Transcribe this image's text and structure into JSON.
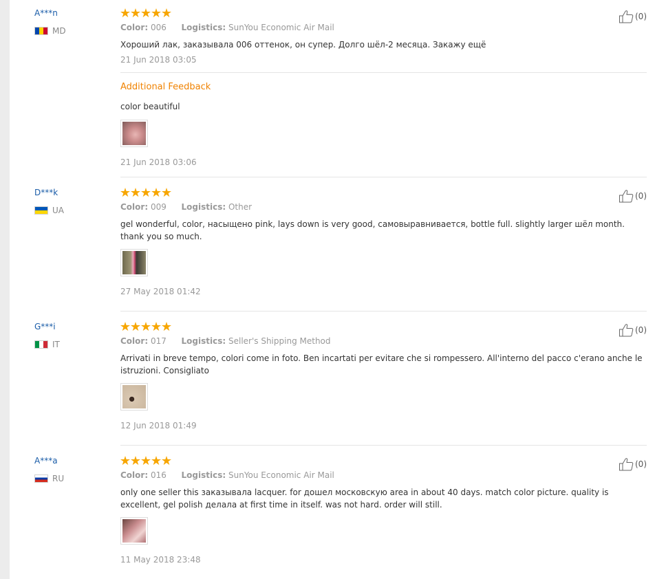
{
  "like_label": "(0)",
  "reviews": [
    {
      "user": "A***n",
      "country": "MD",
      "color_label": "Color:",
      "color": "006",
      "logistics_label": "Logistics:",
      "logistics": "SunYou Economic Air Mail",
      "text": "Хороший лак, заказывала 006 оттенок, он супер. Долго шёл-2 месяца. Закажу ещё",
      "date": "21 Jun 2018 03:05",
      "additional_title": "Additional Feedback",
      "additional_text": "color beautiful",
      "additional_date": "21 Jun 2018 03:06",
      "likes": "(0)"
    },
    {
      "user": "D***k",
      "country": "UA",
      "color_label": "Color:",
      "color": "009",
      "logistics_label": "Logistics:",
      "logistics": "Other",
      "text": "gel wonderful, color, насыщено pink, lays down is very good, самовыравнивается, bottle full. slightly larger шёл month. thank you so much.",
      "date": "27 May 2018 01:42",
      "likes": "(0)"
    },
    {
      "user": "G***i",
      "country": "IT",
      "color_label": "Color:",
      "color": "017",
      "logistics_label": "Logistics:",
      "logistics": "Seller's Shipping Method",
      "text": "Arrivati in breve tempo, colori come in foto. Ben incartati per evitare che si rompessero. All'interno del pacco c'erano anche le istruzioni. Consigliato",
      "date": "12 Jun 2018 01:49",
      "likes": "(0)"
    },
    {
      "user": "A***a",
      "country": "RU",
      "color_label": "Color:",
      "color": "016",
      "logistics_label": "Logistics:",
      "logistics": "SunYou Economic Air Mail",
      "text": "only one seller this заказывала lacquer. for дошел московскую area in about 40 days. match color picture. quality is excellent, gel polish делала at first time in itself. was not hard. order will still.",
      "date": "11 May 2018 23:48",
      "likes": "(0)"
    }
  ],
  "rating_stars": 5,
  "colors": {
    "star": "#f7a600",
    "username": "#1a5ca8",
    "additional_feedback": "#f08200",
    "muted": "#999999"
  },
  "icons": {
    "like": "thumbs-up-icon",
    "star": "star-icon"
  }
}
